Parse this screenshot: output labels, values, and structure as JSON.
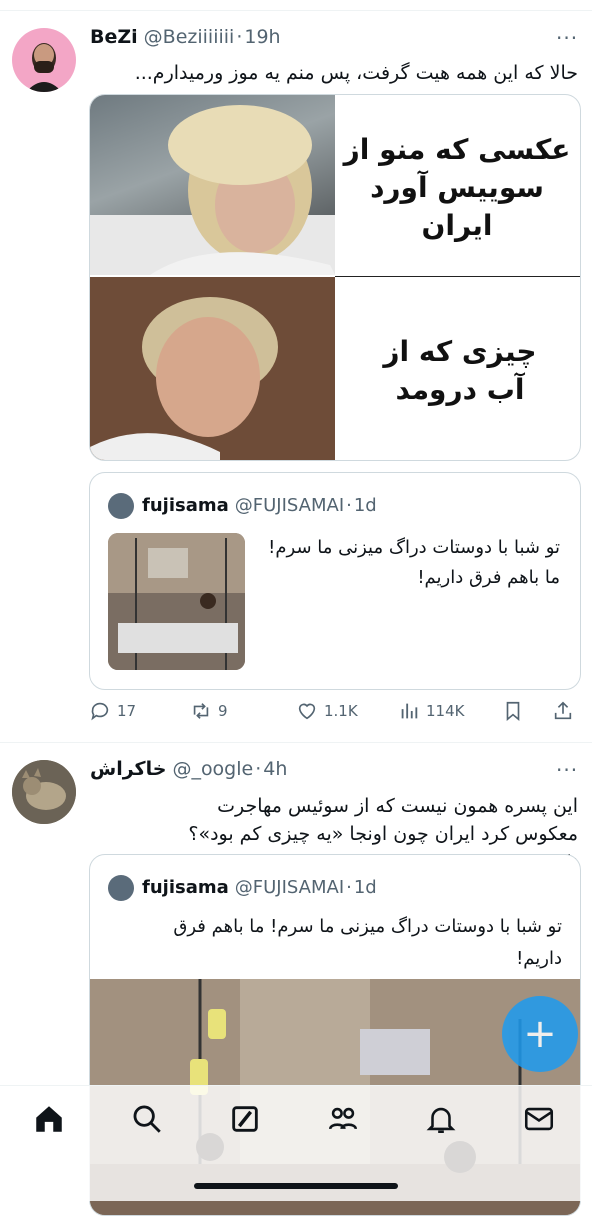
{
  "tweet1": {
    "name": "BeZi",
    "handle": "@Beziiiiiii",
    "time": "19h",
    "text": "حالا که این همه هیت گرفت، پس منم یه موز ورمیدارم...",
    "meme_top": "عکسی که منو از سوییس آورد ایران",
    "meme_bottom": "چیزی که از آب درومد",
    "quote": {
      "name": "fujisama",
      "handle": "@FUJISAMAI",
      "time": "1d",
      "text": "تو شبا با دوستات دراگ میزنی ما سرم! ما باهم فرق داریم!"
    },
    "actions": {
      "replies": "17",
      "retweets": "9",
      "likes": "1.1K",
      "views": "114K"
    }
  },
  "tweet2": {
    "name": "خاکراش",
    "handle": "@_oogle",
    "time": "4h",
    "text": "این پسره همون نیست که از سوئیس مهاجرت معکوس کرد ایران چون اونجا «یه چیزی کم بود»؟ :))))))",
    "quote": {
      "name": "fujisama",
      "handle": "@FUJISAMAI",
      "time": "1d",
      "text": "تو شبا با دوستات دراگ میزنی ما سرم! ما باهم فرق داریم!"
    }
  },
  "icons": {
    "more": "more-horizontal-icon",
    "reply": "reply-icon",
    "retweet": "retweet-icon",
    "like": "heart-icon",
    "views": "views-icon",
    "bookmark": "bookmark-icon",
    "share": "share-icon",
    "compose": "plus-icon"
  },
  "ui": {
    "more_glyph": "···",
    "fab_glyph": "+",
    "dot": "·",
    "accent": "#1d9bf0"
  }
}
